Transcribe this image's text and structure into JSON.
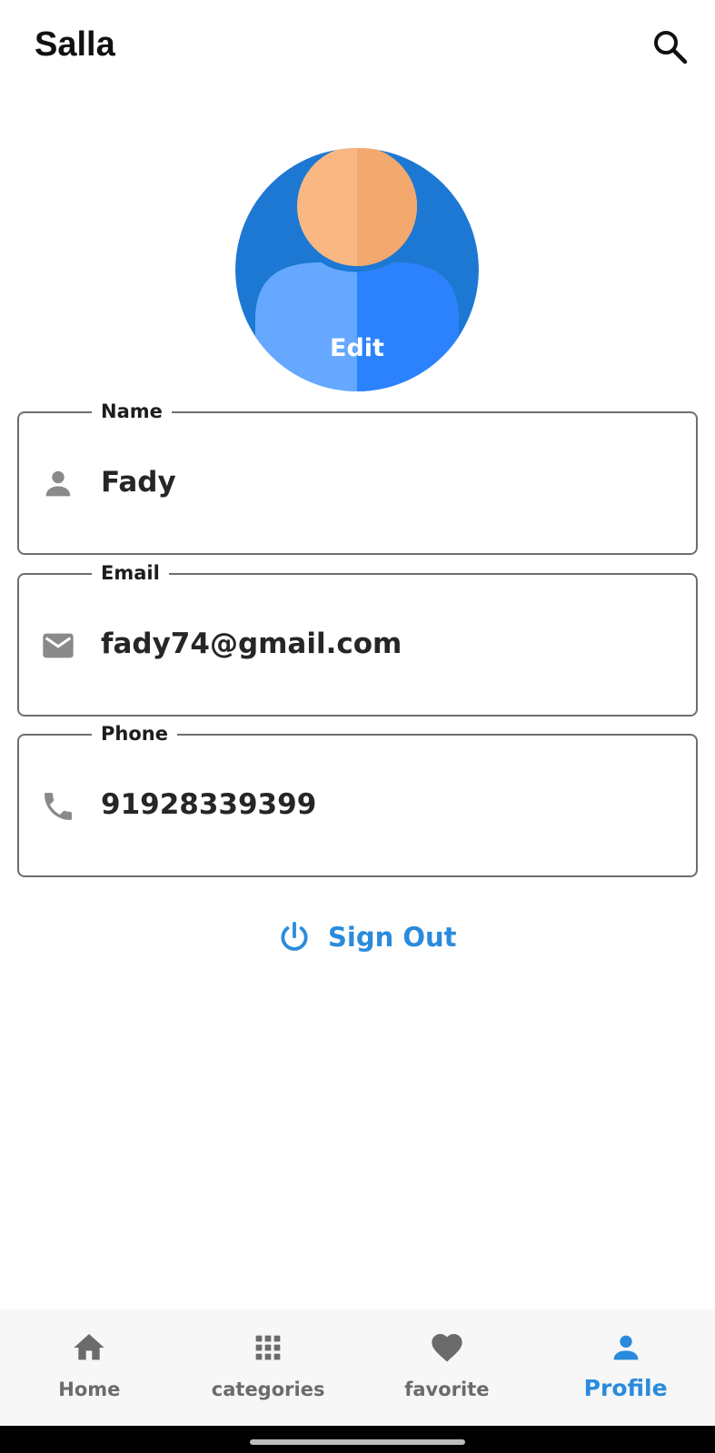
{
  "app": {
    "title": "Salla"
  },
  "avatar": {
    "edit_label": "Edit"
  },
  "fields": [
    {
      "label": "Name",
      "value": "Fady",
      "icon": "person-icon"
    },
    {
      "label": "Email",
      "value": "fady74@gmail.com",
      "icon": "email-icon"
    },
    {
      "label": "Phone",
      "value": "91928339399",
      "icon": "phone-icon"
    }
  ],
  "sign_out": {
    "label": "Sign Out",
    "icon": "power-icon"
  },
  "bottom_nav": {
    "active": "Profile",
    "items": [
      {
        "label": "Home",
        "icon": "home-icon"
      },
      {
        "label": "categories",
        "icon": "grid-icon"
      },
      {
        "label": "favorite",
        "icon": "heart-icon"
      },
      {
        "label": "Profile",
        "icon": "person-icon"
      }
    ]
  },
  "colors": {
    "accent": "#2a8bdc",
    "avatar_bg": "#1d78d3",
    "avatar_head_light": "#f9b883",
    "avatar_head_shade": "#f3a86e",
    "avatar_body_light": "#66a8ff",
    "avatar_body_shade": "#2b82fc",
    "icon_gray": "#8a8a8a"
  }
}
